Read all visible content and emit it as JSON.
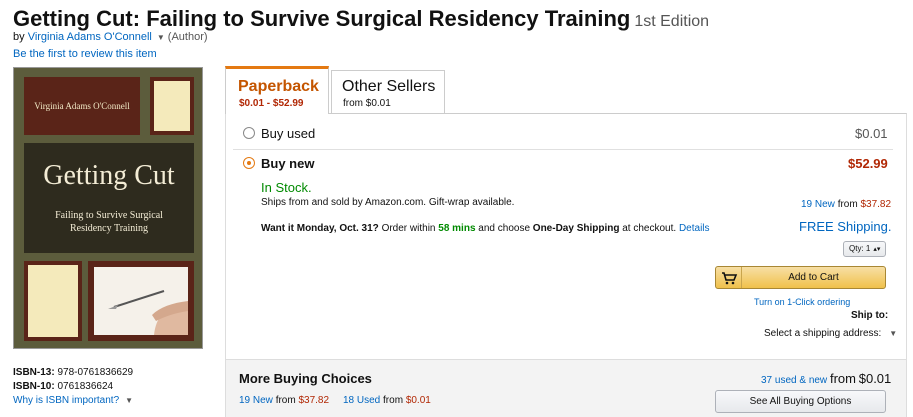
{
  "product": {
    "title": "Getting Cut: Failing to Survive Surgical Residency Training",
    "edition": "1st Edition",
    "by_prefix": "by",
    "author": "Virginia Adams O'Connell",
    "author_role": "(Author)",
    "review_link": "Be the first to review this item"
  },
  "cover": {
    "author": "Virginia Adams O'Connell",
    "title": "Getting Cut",
    "subtitle_line1": "Failing to Survive Surgical",
    "subtitle_line2": "Residency Training"
  },
  "isbn": {
    "isbn13_label": "ISBN-13:",
    "isbn13": "978-0761836629",
    "isbn10_label": "ISBN-10:",
    "isbn10": "0761836624",
    "why_link": "Why is ISBN important?"
  },
  "tabs": [
    {
      "label": "Paperback",
      "price": "$0.01 - $52.99",
      "selected": true
    },
    {
      "label": "Other Sellers",
      "price": "from $0.01",
      "selected": false
    }
  ],
  "options": {
    "used": {
      "label": "Buy used",
      "price": "$0.01"
    },
    "new": {
      "label": "Buy new",
      "price": "$52.99"
    }
  },
  "availability": {
    "status": "In Stock.",
    "ships": "Ships from and sold by Amazon.com. Gift-wrap available.",
    "want_prefix": "Want it Monday, Oct. 31?",
    "order_within": "Order within",
    "time_left": "58 mins",
    "and_choose": "and choose",
    "shipping_option": "One-Day Shipping",
    "at_checkout": "at checkout.",
    "details_link": "Details"
  },
  "offers": {
    "new_count_link": "19 New",
    "from_word": "from",
    "new_from_price": "$37.82",
    "free_shipping": "FREE Shipping.",
    "qty_label": "Qty:",
    "qty_value": "1"
  },
  "cart": {
    "add_label": "Add to Cart",
    "oneclick_link": "Turn on 1-Click ordering",
    "ship_to": "Ship to:",
    "ship_address": "Select a shipping address:"
  },
  "more_buying": {
    "title": "More Buying Choices",
    "summary_link": "37 used & new",
    "summary_from": "from",
    "summary_price": "$0.01",
    "new_link": "19 New",
    "new_from": "from",
    "new_price": "$37.82",
    "used_link": "18 Used",
    "used_from": "from",
    "used_price": "$0.01",
    "see_all": "See All Buying Options"
  },
  "colors": {
    "accent_orange": "#e47911",
    "price_red": "#b12704",
    "link_blue": "#0066c0",
    "stock_green": "#008a00",
    "cart_yellow": "#f0c14b"
  }
}
